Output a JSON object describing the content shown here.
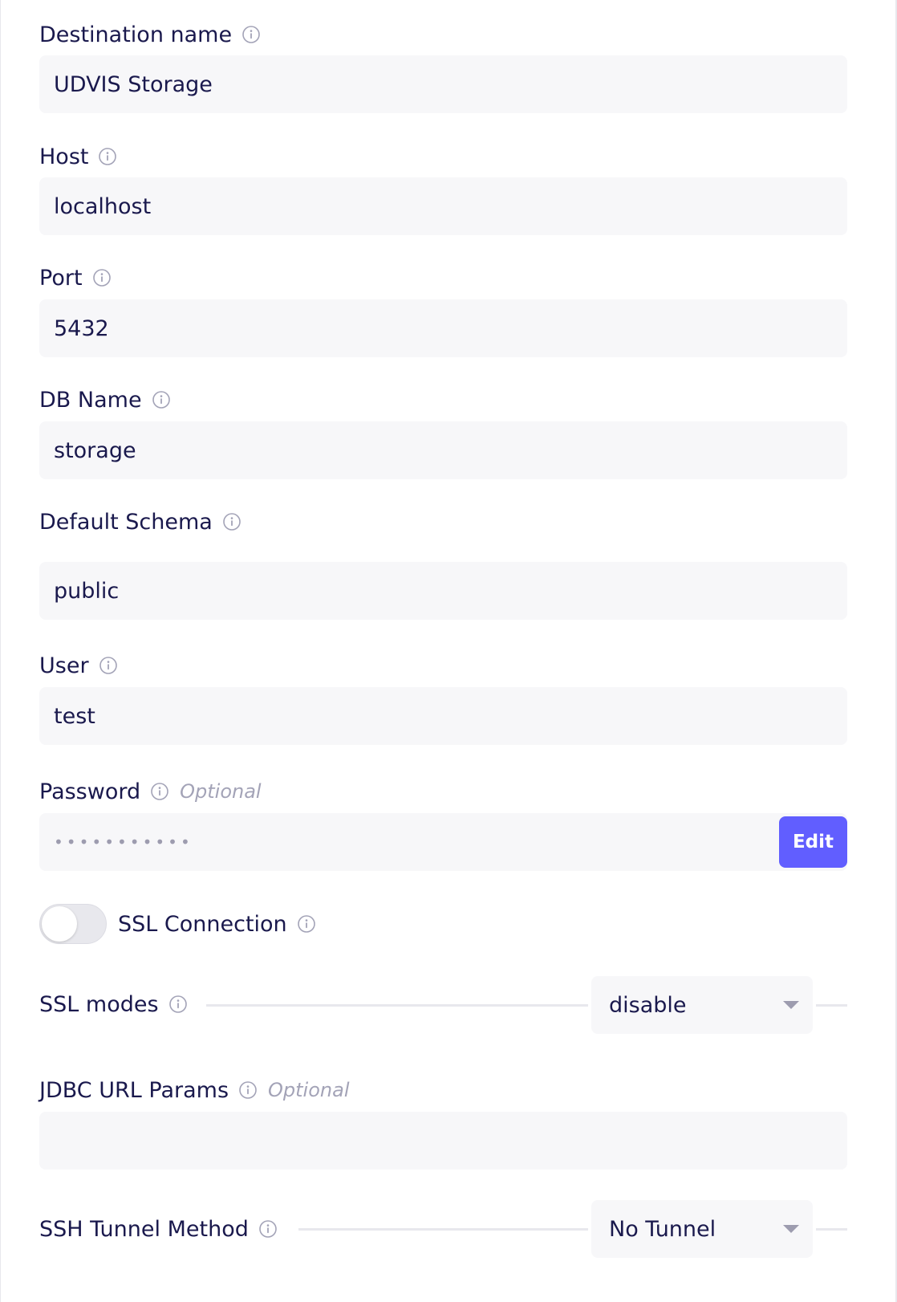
{
  "fields": {
    "destination_name": {
      "label": "Destination name",
      "value": "UDVIS Storage"
    },
    "host": {
      "label": "Host",
      "value": "localhost"
    },
    "port": {
      "label": "Port",
      "value": "5432"
    },
    "db_name": {
      "label": "DB Name",
      "value": "storage"
    },
    "default_schema": {
      "label": "Default Schema",
      "value": "public"
    },
    "user": {
      "label": "User",
      "value": "test"
    },
    "password": {
      "label": "Password",
      "optional": "Optional",
      "masked_value": "•••••••••••",
      "edit_label": "Edit"
    },
    "ssl_connection": {
      "label": "SSL Connection",
      "enabled": false
    },
    "ssl_modes": {
      "label": "SSL modes",
      "selected": "disable"
    },
    "jdbc_url_params": {
      "label": "JDBC URL Params",
      "optional": "Optional",
      "value": ""
    },
    "ssh_tunnel_method": {
      "label": "SSH Tunnel Method",
      "selected": "No Tunnel"
    }
  },
  "icons": {
    "info": "info-circle-icon",
    "dropdown": "chevron-down-icon"
  },
  "colors": {
    "primary": "#615eff",
    "text": "#1a194d",
    "muted": "#a3a3b7",
    "input_bg": "#f7f7f9"
  }
}
